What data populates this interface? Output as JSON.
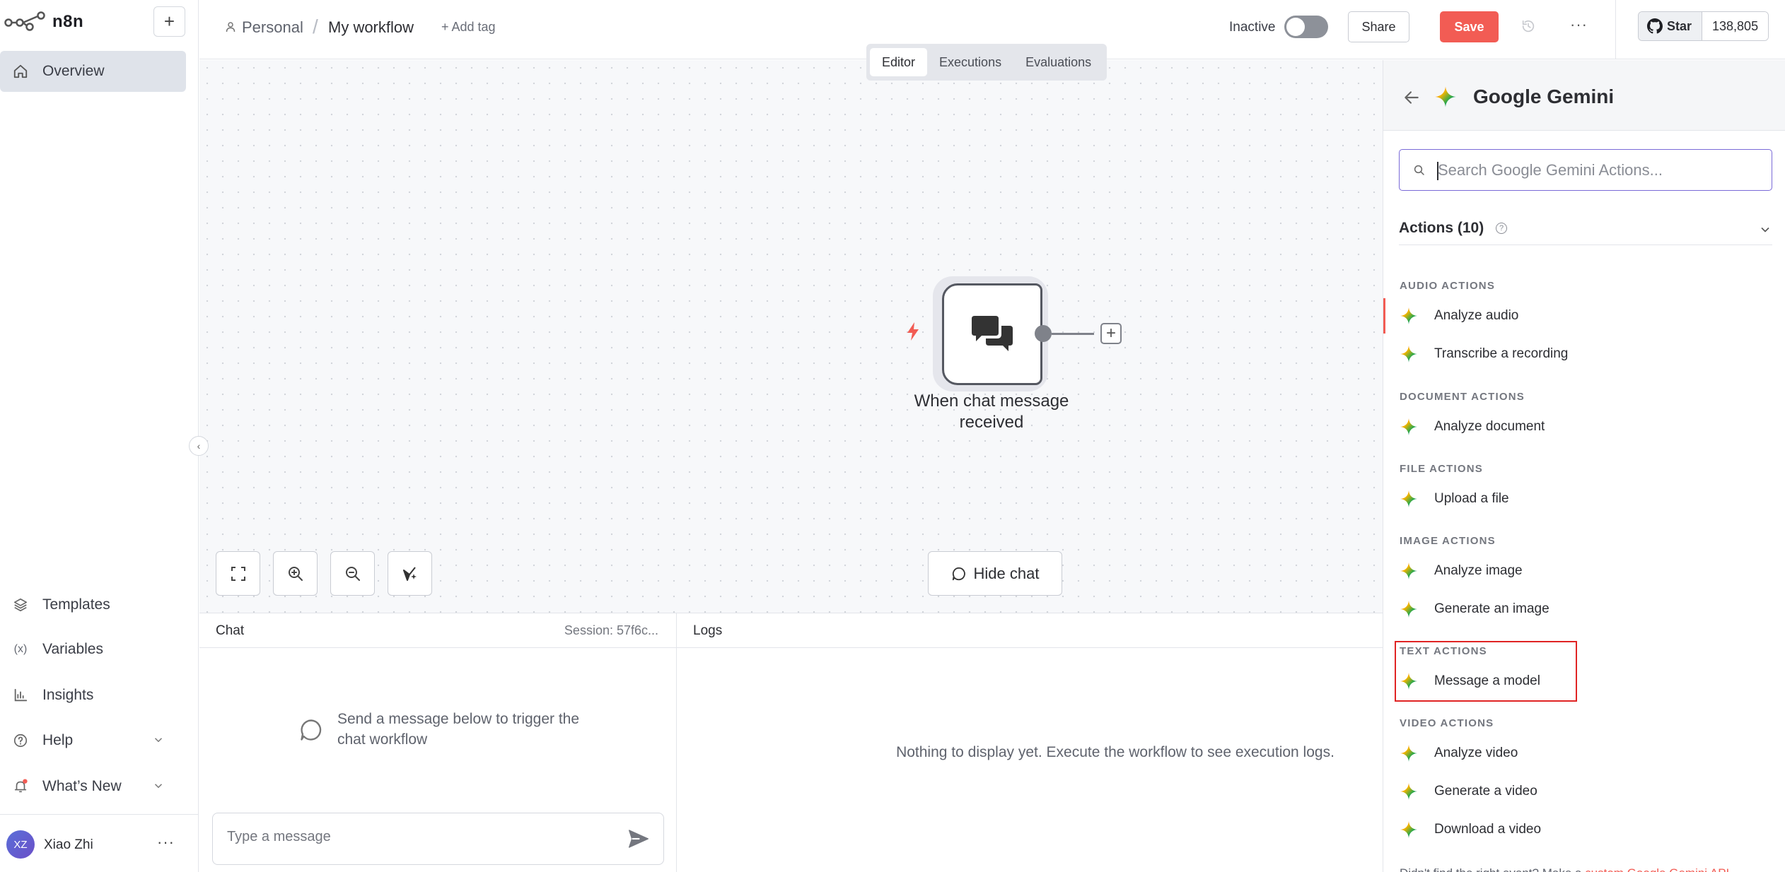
{
  "app": {
    "name": "n8n"
  },
  "sidebar": {
    "new_button": "+",
    "overview": "Overview",
    "bottom_items": [
      {
        "label": "Templates",
        "icon": "templates-icon"
      },
      {
        "label": "Variables",
        "icon": "variables-icon"
      },
      {
        "label": "Insights",
        "icon": "insights-icon"
      },
      {
        "label": "Help",
        "icon": "help-icon"
      },
      {
        "label": "What’s New",
        "icon": "bell-icon"
      }
    ],
    "user": {
      "initials": "XZ",
      "name": "Xiao Zhi",
      "more": "···"
    }
  },
  "header": {
    "breadcrumb_project": "Personal",
    "breadcrumb_sep": "/",
    "workflow_name": "My workflow",
    "add_tag": "+ Add tag",
    "status_label": "Inactive",
    "share": "Share",
    "save": "Save",
    "more": "···",
    "github": {
      "star": "Star",
      "count": "138,805"
    }
  },
  "tabs": [
    "Editor",
    "Executions",
    "Evaluations"
  ],
  "canvas": {
    "node_label": "When chat message received",
    "hide_chat": "Hide chat"
  },
  "chat": {
    "title": "Chat",
    "session": "Session: 57f6c...",
    "empty": "Send a message below to trigger the chat workflow",
    "input_placeholder": "Type a message"
  },
  "logs": {
    "title": "Logs",
    "empty": "Nothing to display yet. Execute the workflow to see execution logs."
  },
  "node_panel": {
    "title": "Google Gemini",
    "search_placeholder": "Search Google Gemini Actions...",
    "actions_header": "Actions (10)",
    "sections": [
      {
        "title": "AUDIO ACTIONS",
        "items": [
          "Analyze audio",
          "Transcribe a recording"
        ]
      },
      {
        "title": "DOCUMENT ACTIONS",
        "items": [
          "Analyze document"
        ]
      },
      {
        "title": "FILE ACTIONS",
        "items": [
          "Upload a file"
        ]
      },
      {
        "title": "IMAGE ACTIONS",
        "items": [
          "Analyze image",
          "Generate an image"
        ]
      },
      {
        "title": "TEXT ACTIONS",
        "items": [
          "Message a model"
        ]
      },
      {
        "title": "VIDEO ACTIONS",
        "items": [
          "Analyze video",
          "Generate a video",
          "Download a video"
        ]
      }
    ],
    "footer_prefix": "Didn't find the right event? Make a ",
    "footer_link": "custom Google Gemini API"
  },
  "colors": {
    "accent": "#f25c54",
    "highlight_box": "#e02424",
    "search_focus": "#7a6ad8"
  }
}
